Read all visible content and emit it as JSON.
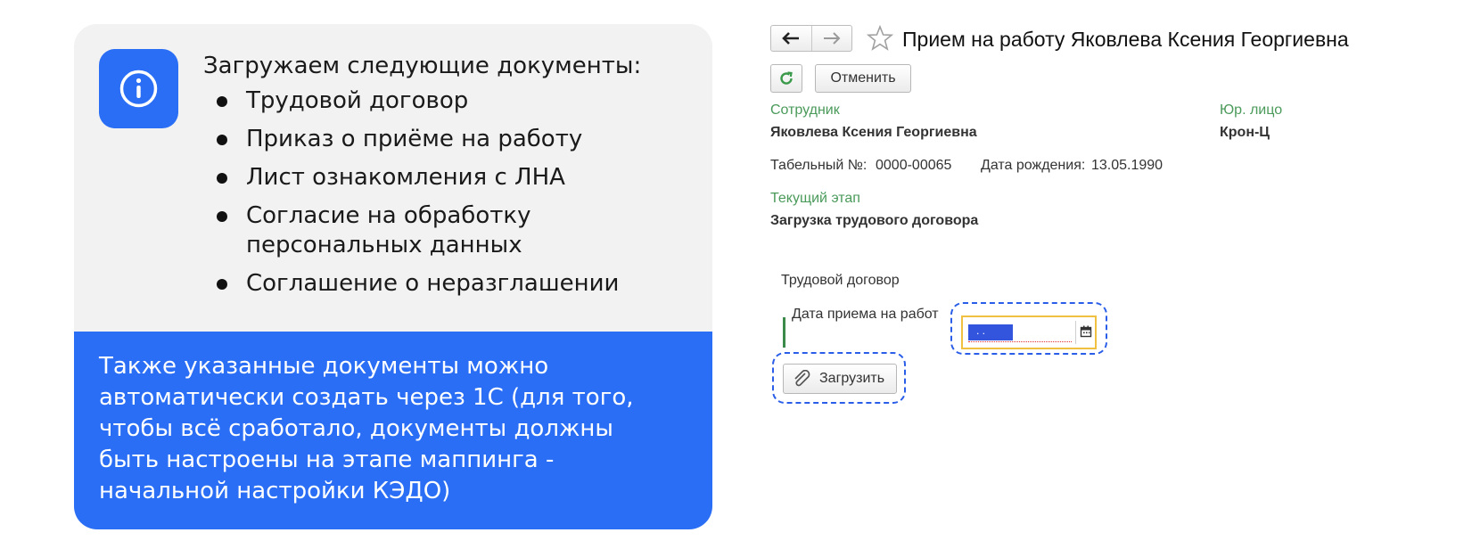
{
  "info": {
    "heading": "Загружаем следующие документы:",
    "documents": [
      "Трудовой договор",
      "Приказ о приёме на работу",
      "Лист ознакомления с ЛНА",
      "Согласие на обработку\nперсональных данных",
      "Соглашение о неразглашении"
    ],
    "note": "Также указанные документы можно автоматически создать через 1С (для того, чтобы всё сработало, документы должны быть настроены на этапе маппинга - начальной настройки КЭДО)",
    "icon": "info-icon",
    "accent_color": "#2a6ef5"
  },
  "form": {
    "title": "Прием на работу Яковлева Ксения Георгиевна",
    "back_icon": "arrow-left-icon",
    "forward_icon": "arrow-right-icon",
    "favorite_icon": "star-icon",
    "refresh_icon": "refresh-icon",
    "cancel_label": "Отменить",
    "employee_label": "Сотрудник",
    "employee_value": "Яковлева Ксения Георгиевна",
    "legal_entity_label": "Юр. лицо",
    "legal_entity_value": "Крон-Ц",
    "tab_number_label": "Табельный №:",
    "tab_number_value": "0000-00065",
    "birth_date_label": "Дата рождения:",
    "birth_date_value": "13.05.1990",
    "stage_label": "Текущий этап",
    "stage_value": "Загрузка трудового договора",
    "contract_group_label": "Трудовой договор",
    "hire_date_label": "Дата приема на работ",
    "hire_date_value": ". .",
    "calendar_icon": "calendar-icon",
    "upload_label": "Загрузить",
    "upload_icon": "paperclip-icon"
  }
}
